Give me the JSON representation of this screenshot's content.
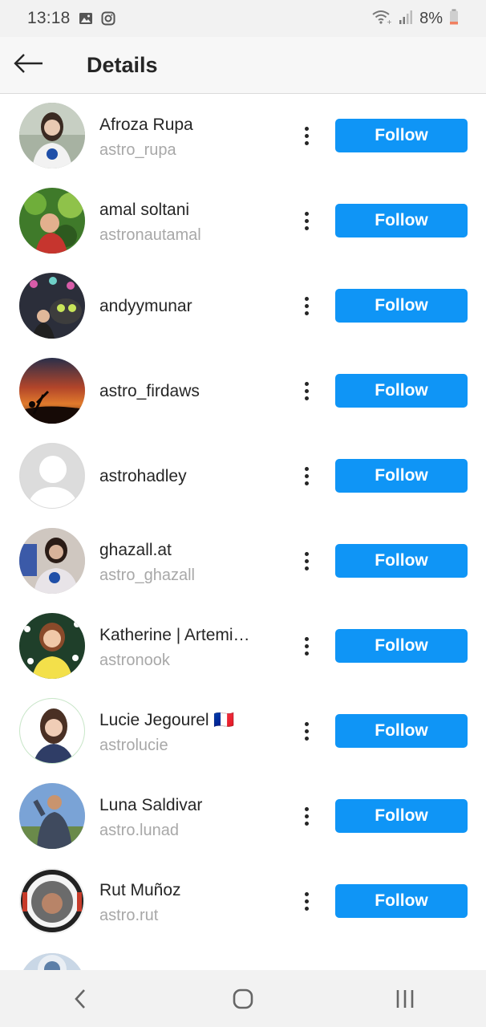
{
  "status_bar": {
    "time": "13:18",
    "battery": "8%",
    "icons": [
      "gallery-icon",
      "instagram-icon",
      "wifi-icon",
      "signal-icon",
      "battery-icon"
    ]
  },
  "header": {
    "title": "Details",
    "back_icon": "arrow-left-icon"
  },
  "colors": {
    "follow_button": "#0f95f6",
    "username_text": "#a8a8a8",
    "header_bg": "#f7f7f7"
  },
  "list": [
    {
      "display_name": "Afroza Rupa",
      "username": "astro_rupa",
      "button": "Follow"
    },
    {
      "display_name": "amal soltani",
      "username": "astronautamal",
      "button": "Follow"
    },
    {
      "display_name": "andyymunar",
      "username": "",
      "button": "Follow"
    },
    {
      "display_name": "astro_firdaws",
      "username": "",
      "button": "Follow"
    },
    {
      "display_name": "astrohadley",
      "username": "",
      "button": "Follow"
    },
    {
      "display_name": "ghazall.at",
      "username": "astro_ghazall",
      "button": "Follow"
    },
    {
      "display_name": "Katherine | Artemi…",
      "username": "astronook",
      "button": "Follow"
    },
    {
      "display_name": "Lucie Jegourel 🇫🇷",
      "username": "astrolucie",
      "button": "Follow"
    },
    {
      "display_name": "Luna Saldivar",
      "username": "astro.lunad",
      "button": "Follow"
    },
    {
      "display_name": "Rut Muñoz",
      "username": "astro.rut",
      "button": "Follow"
    },
    {
      "display_name": "",
      "username": "",
      "button": ""
    }
  ],
  "nav_bar": {
    "icons": [
      "back-nav-icon",
      "home-nav-icon",
      "recents-nav-icon"
    ]
  }
}
